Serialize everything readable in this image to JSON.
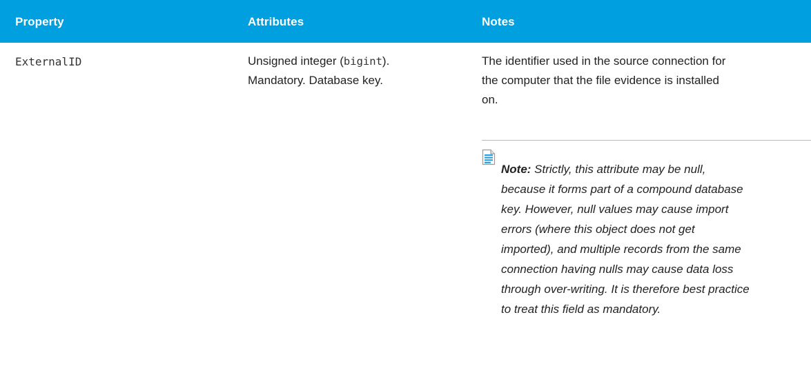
{
  "table": {
    "headers": {
      "property": "Property",
      "attributes": "Attributes",
      "notes": "Notes"
    },
    "row": {
      "property": "ExternalID",
      "attributes": {
        "prefix": "Unsigned integer (",
        "code": "bigint",
        "suffix": ").",
        "line2": "Mandatory. Database key."
      },
      "notes": {
        "text": "The identifier used in the source connection for the computer that the file evidence is installed on.",
        "note_label": "Note:",
        "note_text": " Strictly, this attribute may be null, because it forms part of a compound database key. However, null values may cause import errors (where this object does not get imported), and multiple records from the same connection having nulls may cause data loss through over-writing. It is therefore best practice to treat this field as mandatory."
      }
    }
  },
  "colors": {
    "header_background": "#00a0e0",
    "header_text": "#ffffff",
    "body_text": "#222222",
    "divider": "#b8b8b8"
  },
  "icons": {
    "note": "note-document-icon"
  }
}
